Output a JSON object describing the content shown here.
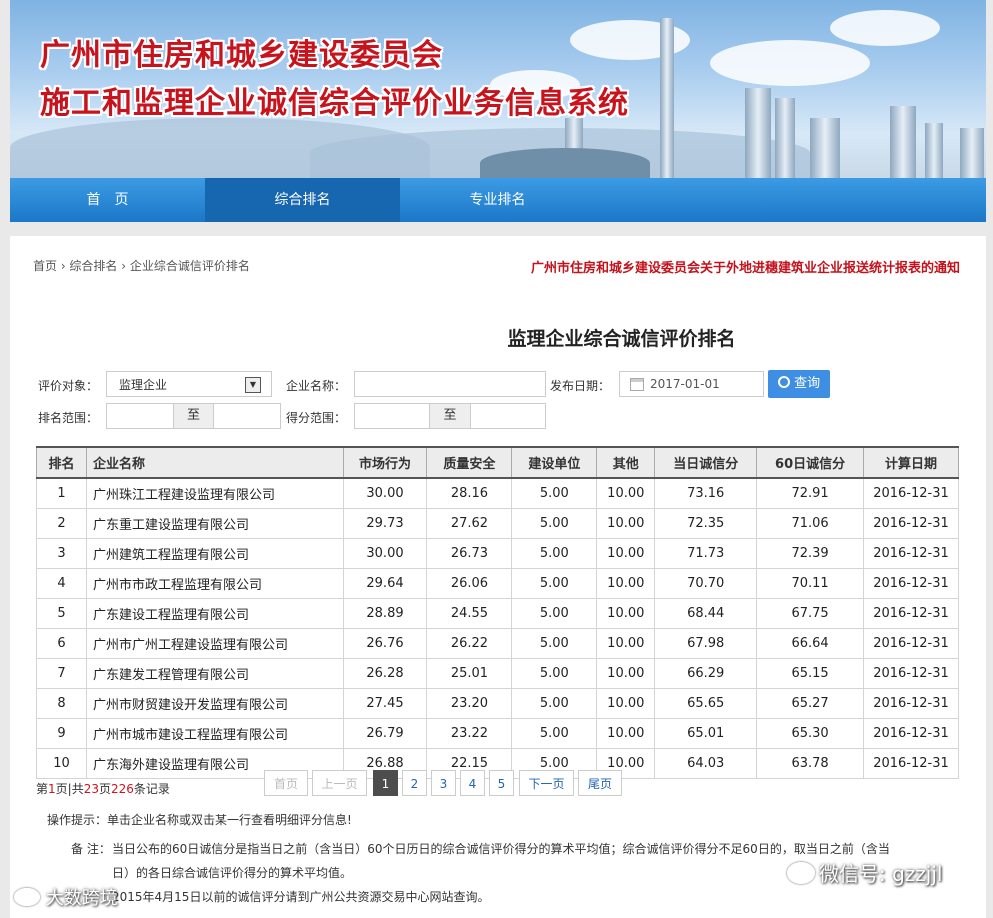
{
  "banner": {
    "title1": "广州市住房和城乡建设委员会",
    "title2": "施工和监理企业诚信综合评价业务信息系统"
  },
  "nav": [
    "首　页",
    "综合排名",
    "专业排名"
  ],
  "breadcrumb": "首页 › 综合排名 › 企业综合诚信评价排名",
  "notice": "广州市住房和城乡建设委员会关于外地进穗建筑业企业报送统计报表的通知",
  "page_title": "监理企业综合诚信评价排名",
  "form": {
    "target_label": "评价对象：",
    "target_value": "监理企业",
    "name_label": "企业名称：",
    "date_label": "发布日期：",
    "date_value": "2017-01-01",
    "search_label": "查询",
    "rank_range_label": "排名范围：",
    "to": "至",
    "score_range_label": "得分范围："
  },
  "table": {
    "headers": [
      "排名",
      "企业名称",
      "市场行为",
      "质量安全",
      "建设单位",
      "其他",
      "当日诚信分",
      "60日诚信分",
      "计算日期"
    ],
    "rows": [
      [
        "1",
        "广州珠江工程建设监理有限公司",
        "30.00",
        "28.16",
        "5.00",
        "10.00",
        "73.16",
        "72.91",
        "2016-12-31"
      ],
      [
        "2",
        "广东重工建设监理有限公司",
        "29.73",
        "27.62",
        "5.00",
        "10.00",
        "72.35",
        "71.06",
        "2016-12-31"
      ],
      [
        "3",
        "广州建筑工程监理有限公司",
        "30.00",
        "26.73",
        "5.00",
        "10.00",
        "71.73",
        "72.39",
        "2016-12-31"
      ],
      [
        "4",
        "广州市市政工程监理有限公司",
        "29.64",
        "26.06",
        "5.00",
        "10.00",
        "70.70",
        "70.11",
        "2016-12-31"
      ],
      [
        "5",
        "广东建设工程监理有限公司",
        "28.89",
        "24.55",
        "5.00",
        "10.00",
        "68.44",
        "67.75",
        "2016-12-31"
      ],
      [
        "6",
        "广州市广州工程建设监理有限公司",
        "26.76",
        "26.22",
        "5.00",
        "10.00",
        "67.98",
        "66.64",
        "2016-12-31"
      ],
      [
        "7",
        "广东建发工程管理有限公司",
        "26.28",
        "25.01",
        "5.00",
        "10.00",
        "66.29",
        "65.15",
        "2016-12-31"
      ],
      [
        "8",
        "广州市财贸建设开发监理有限公司",
        "27.45",
        "23.20",
        "5.00",
        "10.00",
        "65.65",
        "65.27",
        "2016-12-31"
      ],
      [
        "9",
        "广州市城市建设工程监理有限公司",
        "26.79",
        "23.22",
        "5.00",
        "10.00",
        "65.01",
        "65.30",
        "2016-12-31"
      ],
      [
        "10",
        "广东海外建设监理有限公司",
        "26.88",
        "22.15",
        "5.00",
        "10.00",
        "64.03",
        "63.78",
        "2016-12-31"
      ]
    ]
  },
  "pager": {
    "p1": "第",
    "cur": "1",
    "p2": "页|共",
    "total_pages": "23",
    "p3": "页",
    "total_records": "226",
    "p4": "条记录",
    "first": "首页",
    "prev": "上一页",
    "pages": [
      "1",
      "2",
      "3",
      "4",
      "5"
    ],
    "next": "下一页",
    "last": "尾页"
  },
  "tips": {
    "op_label": "操作提示：",
    "op_text": "单击企业名称或双击某一行查看明细评分信息!",
    "note_label": "备 注：",
    "note_line1": "当日公布的60日诚信分是指当日之前（含当日）60个日历日的综合诚信评价得分的算术平均值；综合诚信评价得分不足60日的，取当日之前（含当",
    "note_line2": "日）的各日综合诚信评价得分的算术平均值。",
    "note_line3": "2015年4月15日以前的诚信评分请到广州公共资源交易中心网站查询。"
  },
  "watermark": {
    "left": "大数跨境",
    "right": "微信号: gzzjjl"
  }
}
